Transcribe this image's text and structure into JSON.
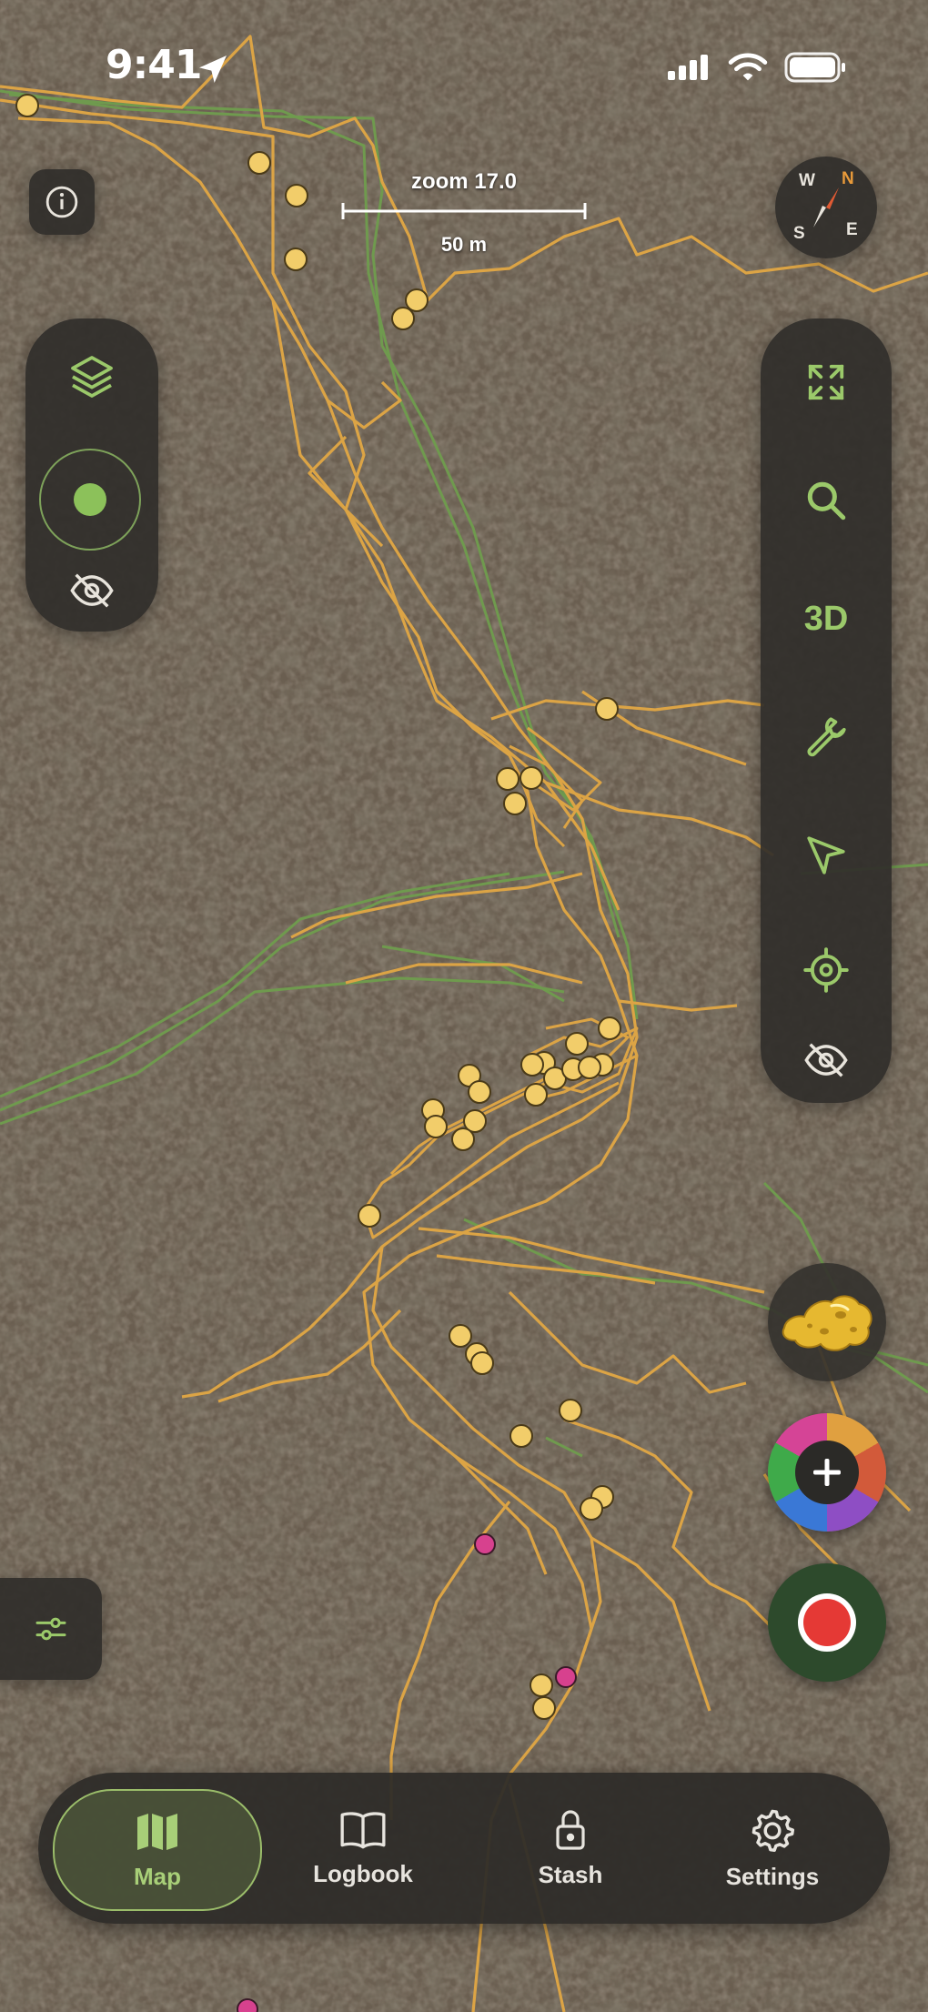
{
  "status_bar": {
    "time": "9:41"
  },
  "scale_bar": {
    "zoom_label": "zoom 17.0",
    "distance_label": "50 m"
  },
  "compass": {
    "north": "N",
    "south": "S",
    "east": "E",
    "west": "W"
  },
  "right_toolbar": {
    "three_d_label": "3D"
  },
  "nav": {
    "tabs": [
      {
        "label": "Map",
        "icon": "map-icon",
        "active": true
      },
      {
        "label": "Logbook",
        "icon": "book-icon",
        "active": false
      },
      {
        "label": "Stash",
        "icon": "lock-icon",
        "active": false
      },
      {
        "label": "Settings",
        "icon": "gear-icon",
        "active": false
      }
    ]
  },
  "colors": {
    "track_orange": "#dca445",
    "track_green": "#6f9a4e",
    "waypoint_yellow": "#f2cd6a",
    "waypoint_pink": "#d7418e",
    "accent_green": "#9bc96a",
    "record_red": "#e53935"
  }
}
